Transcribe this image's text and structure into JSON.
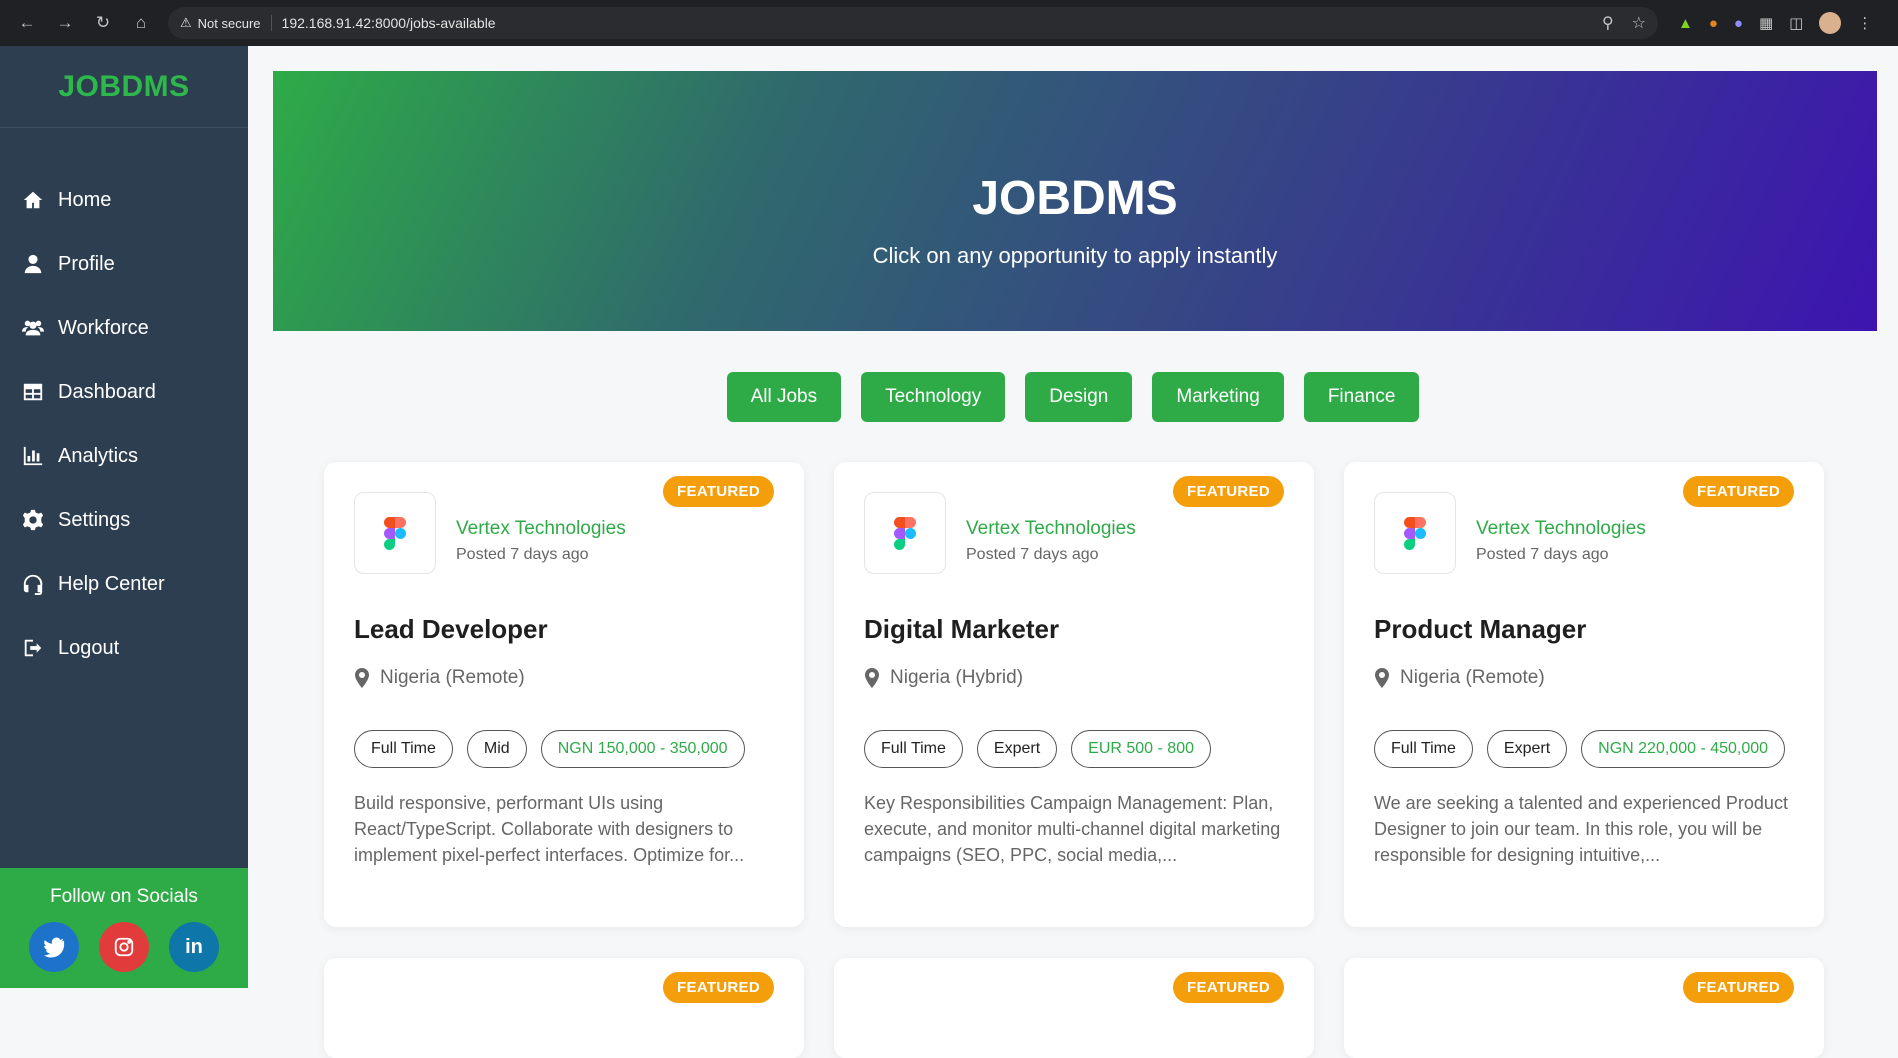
{
  "browser": {
    "security": "Not secure",
    "url": "192.168.91.42:8000/jobs-available"
  },
  "sidebar": {
    "brand": "JOBDMS",
    "items": [
      {
        "label": "Home",
        "icon": "home-icon"
      },
      {
        "label": "Profile",
        "icon": "user-icon"
      },
      {
        "label": "Workforce",
        "icon": "users-icon"
      },
      {
        "label": "Dashboard",
        "icon": "table-icon"
      },
      {
        "label": "Analytics",
        "icon": "chart-icon"
      },
      {
        "label": "Settings",
        "icon": "gear-icon"
      },
      {
        "label": "Help Center",
        "icon": "headset-icon"
      },
      {
        "label": "Logout",
        "icon": "logout-icon"
      }
    ],
    "socials": {
      "title": "Follow on Socials",
      "twitter_color": "#1d72c9",
      "instagram_color": "#e23b3b",
      "linkedin_color": "#0e76a8"
    }
  },
  "hero": {
    "title": "JOBDMS",
    "subtitle": "Click on any opportunity to apply instantly"
  },
  "filters": [
    "All Jobs",
    "Technology",
    "Design",
    "Marketing",
    "Finance"
  ],
  "colors": {
    "accent": "#2eab47",
    "featured": "#f59e0b"
  },
  "jobs": [
    {
      "badge": "FEATURED",
      "company": "Vertex Technologies",
      "posted": "Posted 7 days ago",
      "title": "Lead Developer",
      "location": "Nigeria (Remote)",
      "type": "Full Time",
      "level": "Mid",
      "salary": "NGN 150,000 - 350,000",
      "description": "Build responsive, performant UIs using React/TypeScript. Collaborate with designers to implement pixel-perfect interfaces. Optimize for..."
    },
    {
      "badge": "FEATURED",
      "company": "Vertex Technologies",
      "posted": "Posted 7 days ago",
      "title": "Digital Marketer",
      "location": "Nigeria (Hybrid)",
      "type": "Full Time",
      "level": "Expert",
      "salary": "EUR 500 - 800",
      "description": "Key Responsibilities Campaign Management: Plan, execute, and monitor multi-channel digital marketing campaigns (SEO, PPC, social media,..."
    },
    {
      "badge": "FEATURED",
      "company": "Vertex Technologies",
      "posted": "Posted 7 days ago",
      "title": "Product Manager",
      "location": "Nigeria (Remote)",
      "type": "Full Time",
      "level": "Expert",
      "salary": "NGN 220,000 - 450,000",
      "description": "We are seeking a talented and experienced Product Designer to join our team. In this role, you will be responsible for designing intuitive,..."
    }
  ],
  "more_jobs_badges": [
    "FEATURED",
    "FEATURED",
    "FEATURED"
  ]
}
